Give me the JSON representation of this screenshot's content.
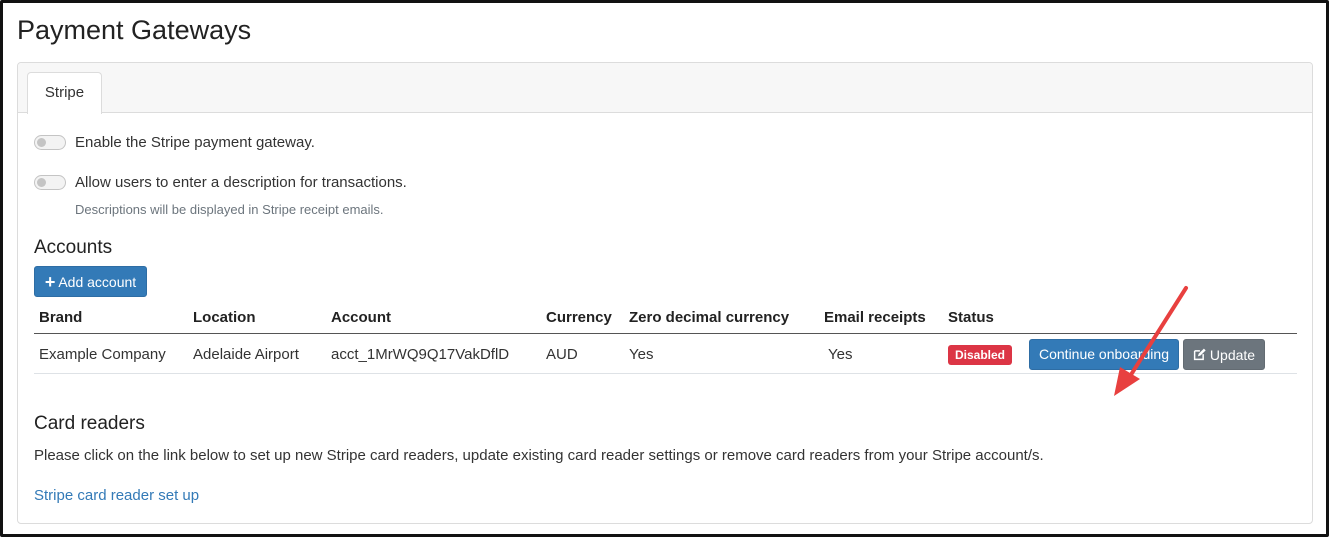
{
  "page": {
    "title": "Payment Gateways"
  },
  "tabs": [
    {
      "label": "Stripe",
      "active": true
    }
  ],
  "settings": {
    "enable_label": "Enable the Stripe payment gateway.",
    "enable_value": false,
    "description_label": "Allow users to enter a description for transactions.",
    "description_value": false,
    "description_help": "Descriptions will be displayed in Stripe receipt emails."
  },
  "accounts": {
    "heading": "Accounts",
    "add_button_icon": "plus-icon",
    "add_button_label": "Add account",
    "columns": [
      "Brand",
      "Location",
      "Account",
      "Currency",
      "Zero decimal currency",
      "Email receipts",
      "Status"
    ],
    "rows": [
      {
        "brand": "Example Company",
        "location": "Adelaide Airport",
        "account": "acct_1MrWQ9Q17VakDflD",
        "currency": "AUD",
        "zero_decimal": "Yes",
        "email_receipts": "Yes",
        "status": "Disabled",
        "continue_label": "Continue onboarding",
        "update_icon": "edit-icon",
        "update_label": "Update"
      }
    ]
  },
  "card_readers": {
    "heading": "Card readers",
    "text": "Please click on the link below to set up new Stripe card readers, update existing card reader settings or remove card readers from your Stripe account/s.",
    "link_label": "Stripe card reader set up"
  },
  "colors": {
    "primary": "#337ab7",
    "secondary": "#6c757d",
    "danger": "#dc3545",
    "annotation_arrow": "#e8403f"
  }
}
